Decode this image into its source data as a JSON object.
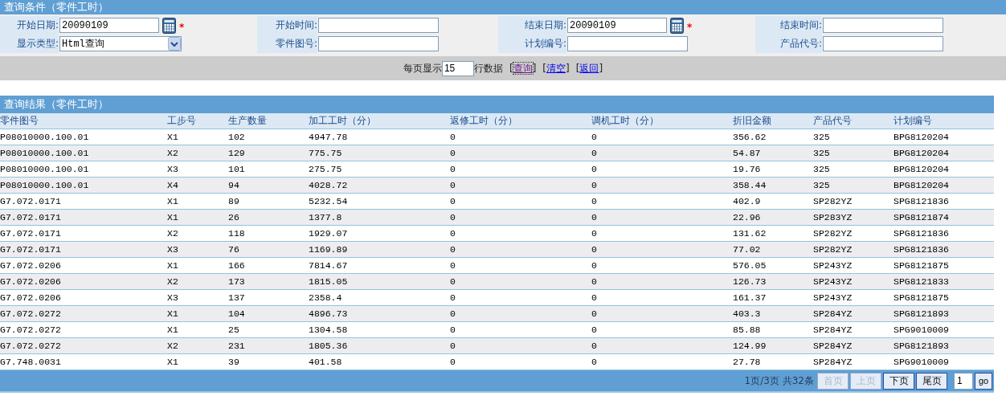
{
  "query_panel": {
    "title": "查询条件（零件工时）",
    "fields": [
      {
        "label": "开始日期:",
        "kind": "date",
        "value": "20090109",
        "required_mark": "*"
      },
      {
        "label": "开始时间:",
        "kind": "text"
      },
      {
        "label": "结束日期:",
        "kind": "date",
        "value": "20090109",
        "required_mark": "*"
      },
      {
        "label": "结束时间:",
        "kind": "text"
      },
      {
        "label": "显示类型:",
        "kind": "select",
        "value": "Html查询"
      },
      {
        "label": "零件图号:",
        "kind": "text"
      },
      {
        "label": "计划编号:",
        "kind": "text"
      },
      {
        "label": "产品代号:",
        "kind": "text"
      }
    ],
    "page_size_label": "每页显示",
    "page_size": "15",
    "page_size_suffix": "行数据",
    "links": [
      {
        "open": "[",
        "label": "查询",
        "close": "]",
        "visited": true
      },
      {
        "open": "[",
        "label": "清空",
        "close": "]",
        "visited": false
      },
      {
        "open": "[",
        "label": "返回",
        "close": "]",
        "visited": false
      }
    ]
  },
  "results": {
    "title": "查询结果（零件工时）",
    "columns": [
      "零件图号",
      "工步号",
      "生产数量",
      "加工工时（分）",
      "返修工时（分）",
      "调机工时（分）",
      "折旧金额",
      "产品代号",
      "计划编号"
    ],
    "rows": [
      [
        "P08010000.100.01",
        "X1",
        "102",
        "4947.78",
        "0",
        "0",
        "356.62",
        "325",
        "BPG8120204"
      ],
      [
        "P08010000.100.01",
        "X2",
        "129",
        "775.75",
        "0",
        "0",
        "54.87",
        "325",
        "BPG8120204"
      ],
      [
        "P08010000.100.01",
        "X3",
        "101",
        "275.75",
        "0",
        "0",
        "19.76",
        "325",
        "BPG8120204"
      ],
      [
        "P08010000.100.01",
        "X4",
        "94",
        "4028.72",
        "0",
        "0",
        "358.44",
        "325",
        "BPG8120204"
      ],
      [
        "G7.072.0171",
        "X1",
        "89",
        "5232.54",
        "0",
        "0",
        "402.9",
        "SP282YZ",
        "SPG8121836"
      ],
      [
        "G7.072.0171",
        "X1",
        "26",
        "1377.8",
        "0",
        "0",
        "22.96",
        "SP283YZ",
        "SPG8121874"
      ],
      [
        "G7.072.0171",
        "X2",
        "118",
        "1929.07",
        "0",
        "0",
        "131.62",
        "SP282YZ",
        "SPG8121836"
      ],
      [
        "G7.072.0171",
        "X3",
        "76",
        "1169.89",
        "0",
        "0",
        "77.02",
        "SP282YZ",
        "SPG8121836"
      ],
      [
        "G7.072.0206",
        "X1",
        "166",
        "7814.67",
        "0",
        "0",
        "576.05",
        "SP243YZ",
        "SPG8121875"
      ],
      [
        "G7.072.0206",
        "X2",
        "173",
        "1815.05",
        "0",
        "0",
        "126.73",
        "SP243YZ",
        "SPG8121833"
      ],
      [
        "G7.072.0206",
        "X3",
        "137",
        "2358.4",
        "0",
        "0",
        "161.37",
        "SP243YZ",
        "SPG8121875"
      ],
      [
        "G7.072.0272",
        "X1",
        "104",
        "4896.73",
        "0",
        "0",
        "403.3",
        "SP284YZ",
        "SPG8121893"
      ],
      [
        "G7.072.0272",
        "X1",
        "25",
        "1304.58",
        "0",
        "0",
        "85.88",
        "SP284YZ",
        "SPG9010009"
      ],
      [
        "G7.072.0272",
        "X2",
        "231",
        "1805.36",
        "0",
        "0",
        "124.99",
        "SP284YZ",
        "SPG8121893"
      ],
      [
        "G7.748.0031",
        "X1",
        "39",
        "401.58",
        "0",
        "0",
        "27.78",
        "SP284YZ",
        "SPG9010009"
      ]
    ],
    "pager": {
      "info": "1页/3页 共32条",
      "buttons": [
        {
          "label": "首页",
          "disabled": true
        },
        {
          "label": "上页",
          "disabled": true
        },
        {
          "label": "下页",
          "disabled": false
        },
        {
          "label": "尾页",
          "disabled": false
        }
      ],
      "page_input": "1",
      "go": "go"
    }
  }
}
